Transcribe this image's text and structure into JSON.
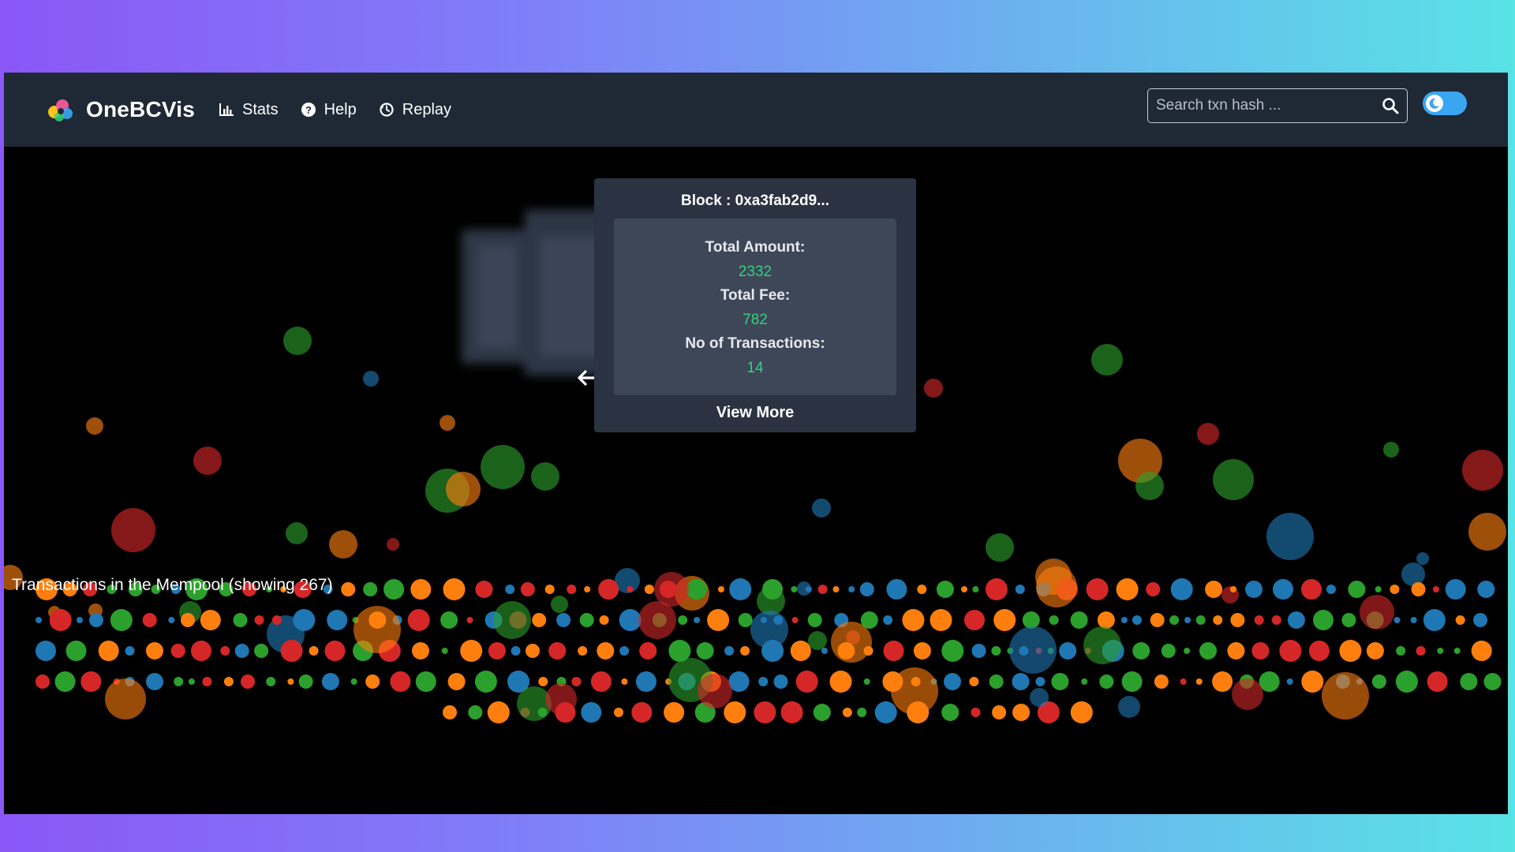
{
  "app": {
    "brand_name": "OneBCVis",
    "logo_colors": [
      "#f5c518",
      "#ff5aa0",
      "#3aa6f1",
      "#35d07f"
    ]
  },
  "nav": {
    "items": [
      {
        "label": "Stats",
        "icon": "bar-chart-icon"
      },
      {
        "label": "Help",
        "icon": "question-circle-icon"
      },
      {
        "label": "Replay",
        "icon": "replay-icon"
      }
    ]
  },
  "search": {
    "placeholder": "Search txn hash ...",
    "value": "",
    "icon": "search-icon"
  },
  "theme_toggle": {
    "icon": "moon-icon",
    "state": "dark",
    "color": "#3aa6f1"
  },
  "block_card": {
    "title": "Block : 0xa3fab2d9...",
    "total_amount_label": "Total Amount:",
    "total_amount": "2332",
    "total_fee_label": "Total Fee:",
    "total_fee": "782",
    "tx_count_label": "No of Transactions:",
    "tx_count": "14",
    "view_more_label": "View More"
  },
  "mempool": {
    "label": "Transactions in the Mempool (showing 267)",
    "count": 267
  },
  "colors": {
    "green": "#2ca02c",
    "blue": "#1f77b4",
    "red": "#d62728",
    "orange": "#ff7f0e",
    "value_green": "#35d07f",
    "navbar_bg": "#1f2835",
    "card_bg": "#2b3342"
  }
}
